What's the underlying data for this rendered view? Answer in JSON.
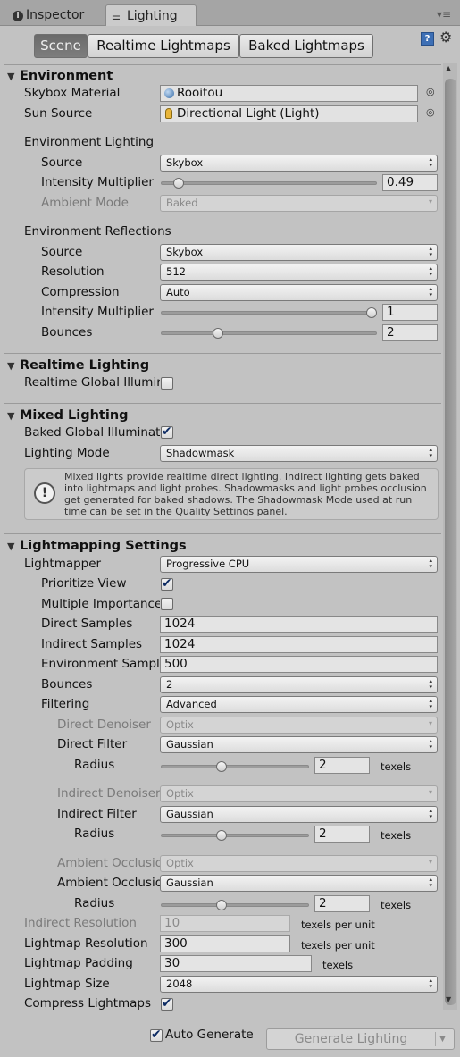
{
  "window": {
    "tabs": [
      {
        "label": "Inspector",
        "icon": "info-icon",
        "active": false
      },
      {
        "label": "Lighting",
        "icon": "lighting-icon",
        "active": true
      }
    ],
    "menu_icon": "menu-icon"
  },
  "toolbar": {
    "segments": [
      "Scene",
      "Realtime Lightmaps",
      "Baked Lightmaps"
    ],
    "selected": "Scene"
  },
  "environment": {
    "header": "Environment",
    "skybox_label": "Skybox Material",
    "skybox_value": "Rooitou",
    "sun_label": "Sun Source",
    "sun_value": "Directional Light (Light)",
    "env_lighting_title": "Environment Lighting",
    "source_label": "Source",
    "source_value": "Skybox",
    "intensity_label": "Intensity Multiplier",
    "intensity_value": "0.49",
    "intensity_fraction": 0.06,
    "ambient_label": "Ambient Mode",
    "ambient_value": "Baked",
    "reflections_title": "Environment Reflections",
    "refl_source_label": "Source",
    "refl_source_value": "Skybox",
    "resolution_label": "Resolution",
    "resolution_value": "512",
    "compression_label": "Compression",
    "compression_value": "Auto",
    "refl_intensity_label": "Intensity Multiplier",
    "refl_intensity_value": "1",
    "refl_intensity_fraction": 1.0,
    "bounces_label": "Bounces",
    "bounces_value": "2",
    "bounces_fraction": 0.25
  },
  "realtime": {
    "header": "Realtime Lighting",
    "gi_label": "Realtime Global Illumination",
    "gi_checked": false
  },
  "mixed": {
    "header": "Mixed Lighting",
    "baked_gi_label": "Baked Global Illumination",
    "baked_gi_checked": true,
    "mode_label": "Lighting Mode",
    "mode_value": "Shadowmask",
    "info_text": "Mixed lights provide realtime direct lighting. Indirect lighting gets baked into lightmaps and light probes. Shadowmasks and light probes occlusion get generated for baked shadows. The Shadowmask Mode used at run time can be set in the Quality Settings panel."
  },
  "lightmapping": {
    "header": "Lightmapping Settings",
    "lightmapper_label": "Lightmapper",
    "lightmapper_value": "Progressive CPU",
    "prioritize_label": "Prioritize View",
    "prioritize_checked": true,
    "mis_label": "Multiple Importance Sampling",
    "mis_checked": false,
    "direct_samples_label": "Direct Samples",
    "direct_samples_value": "1024",
    "indirect_samples_label": "Indirect Samples",
    "indirect_samples_value": "1024",
    "env_samples_label": "Environment Samples",
    "env_samples_value": "500",
    "bounces_label": "Bounces",
    "bounces_value": "2",
    "filtering_label": "Filtering",
    "filtering_value": "Advanced",
    "direct_denoiser_label": "Direct Denoiser",
    "direct_denoiser_value": "Optix",
    "direct_filter_label": "Direct Filter",
    "direct_filter_value": "Gaussian",
    "radius_label": "Radius",
    "direct_radius_value": "2",
    "direct_radius_fraction": 0.4,
    "texels_label": "texels",
    "indirect_denoiser_label": "Indirect Denoiser",
    "indirect_denoiser_value": "Optix",
    "indirect_filter_label": "Indirect Filter",
    "indirect_filter_value": "Gaussian",
    "indirect_radius_value": "2",
    "indirect_radius_fraction": 0.4,
    "ao_denoiser_label": "Ambient Occlusion Denoiser",
    "ao_denoiser_value": "Optix",
    "ao_filter_label": "Ambient Occlusion Filter",
    "ao_filter_value": "Gaussian",
    "ao_radius_value": "2",
    "ao_radius_fraction": 0.4,
    "indirect_res_label": "Indirect Resolution",
    "indirect_res_value": "10",
    "texels_per_unit_label": "texels per unit",
    "lightmap_res_label": "Lightmap Resolution",
    "lightmap_res_value": "300",
    "padding_label": "Lightmap Padding",
    "padding_value": "30",
    "size_label": "Lightmap Size",
    "size_value": "2048",
    "compress_label": "Compress Lightmaps",
    "compress_checked": true
  },
  "footer": {
    "auto_generate_label": "Auto Generate",
    "auto_generate_checked": true,
    "generate_label": "Generate Lighting"
  }
}
